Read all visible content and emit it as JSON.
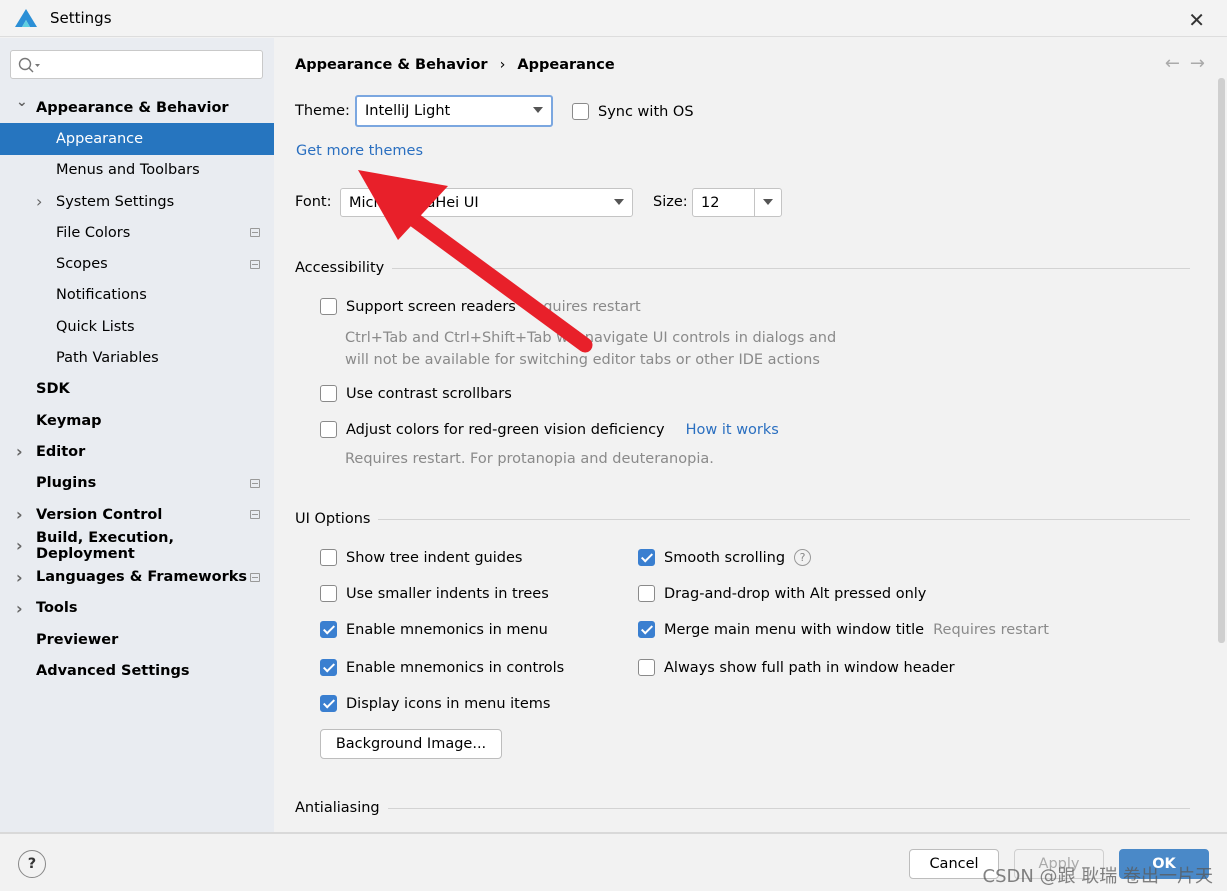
{
  "window": {
    "title": "Settings",
    "close_icon": "close-icon"
  },
  "sidebar": {
    "search_placeholder": "",
    "items": [
      {
        "label": "Appearance & Behavior",
        "level": 0,
        "bold": true,
        "expanded": true
      },
      {
        "label": "Appearance",
        "level": 1,
        "selected": true
      },
      {
        "label": "Menus and Toolbars",
        "level": 1
      },
      {
        "label": "System Settings",
        "level": 1,
        "collapsed": true
      },
      {
        "label": "File Colors",
        "level": 1,
        "badge": true
      },
      {
        "label": "Scopes",
        "level": 1,
        "badge": true
      },
      {
        "label": "Notifications",
        "level": 1
      },
      {
        "label": "Quick Lists",
        "level": 1
      },
      {
        "label": "Path Variables",
        "level": 1
      },
      {
        "label": "SDK",
        "level": 0,
        "bold": true
      },
      {
        "label": "Keymap",
        "level": 0,
        "bold": true
      },
      {
        "label": "Editor",
        "level": 0,
        "bold": true,
        "collapsed": true
      },
      {
        "label": "Plugins",
        "level": 0,
        "bold": true,
        "badge": true
      },
      {
        "label": "Version Control",
        "level": 0,
        "bold": true,
        "collapsed": true,
        "badge": true
      },
      {
        "label": "Build, Execution, Deployment",
        "level": 0,
        "bold": true,
        "collapsed": true
      },
      {
        "label": "Languages & Frameworks",
        "level": 0,
        "bold": true,
        "collapsed": true,
        "badge": true
      },
      {
        "label": "Tools",
        "level": 0,
        "bold": true,
        "collapsed": true
      },
      {
        "label": "Previewer",
        "level": 0,
        "bold": true
      },
      {
        "label": "Advanced Settings",
        "level": 0,
        "bold": true
      }
    ]
  },
  "main": {
    "breadcrumb": [
      "Appearance & Behavior",
      "Appearance"
    ],
    "theme_label": "Theme:",
    "theme_value": "IntelliJ Light",
    "sync_label": "Sync with OS",
    "get_more_themes": "Get more themes",
    "font_label": "Font:",
    "font_value": "Microsoft YaHei UI",
    "size_label": "Size:",
    "size_value": "12",
    "accessibility": {
      "title": "Accessibility",
      "screen_readers": "Support screen readers",
      "screen_readers_note": "Requires restart",
      "screen_readers_desc1": "Ctrl+Tab and Ctrl+Shift+Tab will navigate UI controls in dialogs and",
      "screen_readers_desc2": "will not be available for switching editor tabs or other IDE actions",
      "contrast": "Use contrast scrollbars",
      "redgreen": "Adjust colors for red-green vision deficiency",
      "how_it_works": "How it works",
      "redgreen_note": "Requires restart. For protanopia and deuteranopia."
    },
    "ui_options": {
      "title": "UI Options",
      "left": [
        {
          "label": "Show tree indent guides",
          "checked": false
        },
        {
          "label": "Use smaller indents in trees",
          "checked": false
        },
        {
          "label": "Enable mnemonics in menu",
          "checked": true
        },
        {
          "label": "Enable mnemonics in controls",
          "checked": true
        },
        {
          "label": "Display icons in menu items",
          "checked": true
        }
      ],
      "right": [
        {
          "label": "Smooth scrolling",
          "checked": true
        },
        {
          "label": "Drag-and-drop with Alt pressed only",
          "checked": false
        },
        {
          "label": "Merge main menu with window title",
          "checked": true,
          "note": "Requires restart"
        },
        {
          "label": "Always show full path in window header",
          "checked": false
        }
      ],
      "background_image": "Background Image..."
    },
    "antialiasing": {
      "title": "Antialiasing"
    }
  },
  "footer": {
    "cancel": "Cancel",
    "apply": "Apply",
    "ok": "OK",
    "watermark": "CSDN @跟 耿瑞 卷出一片天"
  },
  "colors": {
    "accent": "#2675bf",
    "link": "#2a6fc0",
    "arrow": "#e8202a"
  }
}
